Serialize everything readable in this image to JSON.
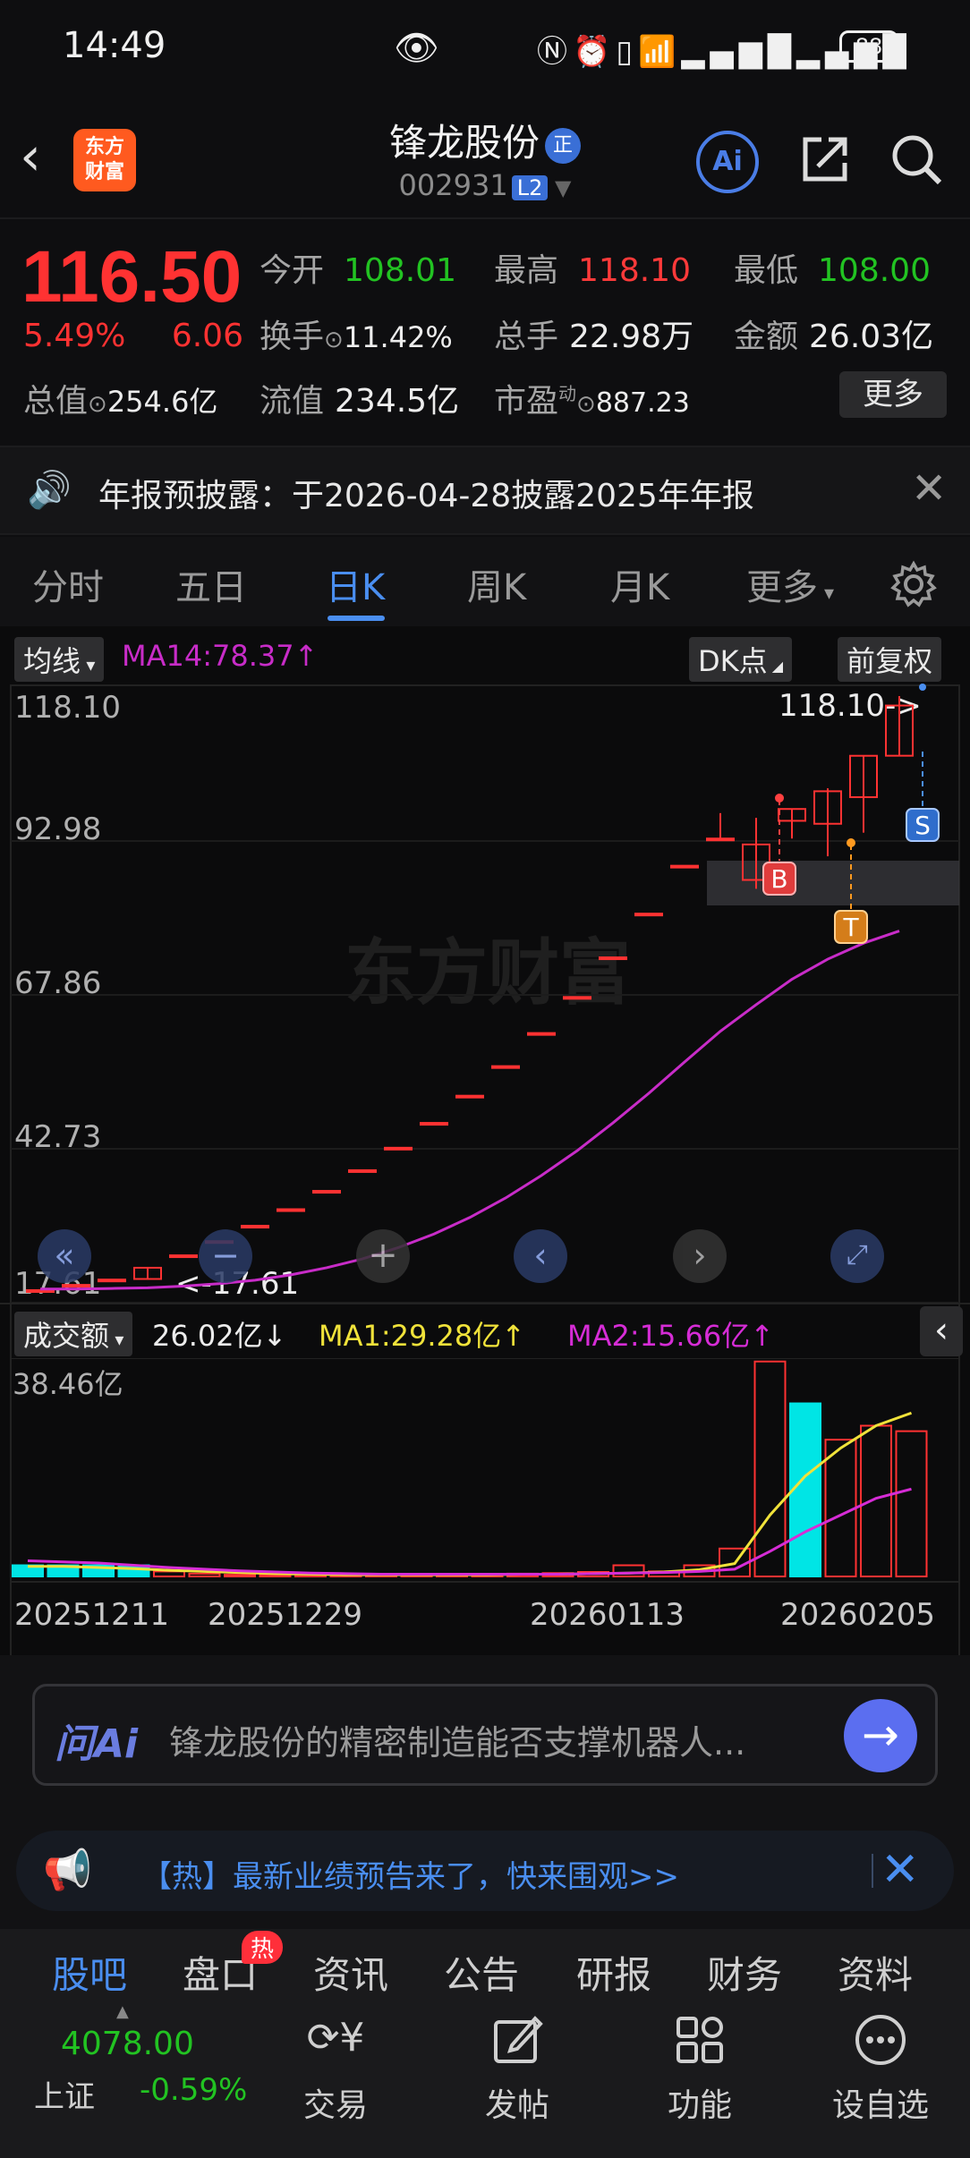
{
  "status_bar": {
    "time": "14:49",
    "battery": "88"
  },
  "header": {
    "stock_name": "锋龙股份",
    "badge": "正",
    "code": "002931",
    "level": "L2",
    "ai_label": "Ai"
  },
  "quote": {
    "price": "116.50",
    "change_pct": "5.49%",
    "change": "6.06",
    "open_label": "今开",
    "open": "108.01",
    "high_label": "最高",
    "high": "118.10",
    "low_label": "最低",
    "low": "108.00",
    "turnover_label": "换手",
    "turnover": "11.42%",
    "volume_label": "总手",
    "volume": "22.98万",
    "amount_label": "金额",
    "amount": "26.03亿",
    "mktcap_label": "总值",
    "mktcap": "254.6亿",
    "float_label": "流值",
    "float": "234.5亿",
    "pe_label": "市盈",
    "pe_sup": "动",
    "pe": "887.23",
    "more": "更多"
  },
  "notice": {
    "text": "年报预披露：于2026-04-28披露2025年年报"
  },
  "tabs": [
    "分时",
    "五日",
    "日K",
    "周K",
    "月K",
    "更多"
  ],
  "kline": {
    "ma_selector": "均线",
    "ma_label": "MA14:78.37↑",
    "dk_button": "DK点",
    "adjust_button": "前复权",
    "y_ticks": [
      "118.10",
      "92.98",
      "67.86",
      "42.73",
      "17.61"
    ],
    "max_label": "118.10->",
    "min_label": "<-17.61",
    "watermark": "东方财富",
    "markers": {
      "b": "B",
      "t": "T",
      "s": "S"
    }
  },
  "volume": {
    "selector": "成交额",
    "value": "26.02亿↓",
    "ma1": "MA1:29.28亿↑",
    "ma2": "MA2:15.66亿↑",
    "y_max": "38.46亿",
    "x_ticks": [
      "20251211",
      "20251229",
      "20260113",
      "20260205"
    ]
  },
  "chart_data": {
    "type": "candlestick",
    "price_axis": [
      17.61,
      118.1
    ],
    "ohlc": [
      [
        17.61,
        17.61,
        17.61,
        17.61
      ],
      [
        18.5,
        18.5,
        18.5,
        18.5
      ],
      [
        19.4,
        19.4,
        19.4,
        19.4
      ],
      [
        19.5,
        21.4,
        19.5,
        21.4
      ],
      [
        23.5,
        23.5,
        23.5,
        23.5
      ],
      [
        25.9,
        25.9,
        25.9,
        25.9
      ],
      [
        28.5,
        28.5,
        28.5,
        28.5
      ],
      [
        31.3,
        31.3,
        31.3,
        31.3
      ],
      [
        34.4,
        34.4,
        34.4,
        34.4
      ],
      [
        37.9,
        37.9,
        37.9,
        37.9
      ],
      [
        41.7,
        41.7,
        41.7,
        41.7
      ],
      [
        45.9,
        45.9,
        45.9,
        45.9
      ],
      [
        50.5,
        50.5,
        50.5,
        50.5
      ],
      [
        55.5,
        55.5,
        55.5,
        55.5
      ],
      [
        61.1,
        61.1,
        61.1,
        61.1
      ],
      [
        67.2,
        67.2,
        67.2,
        67.2
      ],
      [
        73.9,
        73.9,
        73.9,
        73.9
      ],
      [
        81.3,
        81.3,
        81.3,
        81.3
      ],
      [
        89.4,
        89.4,
        89.4,
        89.4
      ],
      [
        94.0,
        98.3,
        94.0,
        94.0
      ],
      [
        87.0,
        97.5,
        85.5,
        93.0
      ],
      [
        97.0,
        99.0,
        94.0,
        99.0
      ],
      [
        96.5,
        102.5,
        91.0,
        102.0
      ],
      [
        101.0,
        108.0,
        95.0,
        108.0
      ],
      [
        108.01,
        118.1,
        108.0,
        116.5
      ]
    ],
    "ma14": [
      17.8,
      17.8,
      17.9,
      18.0,
      18.3,
      18.7,
      19.3,
      20.2,
      21.4,
      22.9,
      24.8,
      27.1,
      29.9,
      33.2,
      37.0,
      41.2,
      45.9,
      50.9,
      56.2,
      61.4,
      65.9,
      70.2,
      73.6,
      76.3,
      78.37
    ],
    "volume_axis_max": 38.46,
    "volume_values": [
      2.0,
      2.0,
      2.0,
      2.0,
      0.9,
      0.5,
      0.3,
      0.3,
      0.2,
      0.2,
      0.3,
      0.3,
      0.3,
      0.4,
      0.5,
      0.6,
      0.8,
      2.0,
      0.9,
      2.0,
      5.0,
      38.5,
      31.0,
      24.5,
      27.0,
      26.02
    ],
    "vol_ma1": [
      1.8,
      1.8,
      1.6,
      1.4,
      1.1,
      0.9,
      0.7,
      0.5,
      0.4,
      0.3,
      0.3,
      0.3,
      0.3,
      0.3,
      0.4,
      0.4,
      0.5,
      0.6,
      0.8,
      1.2,
      2.3,
      11.0,
      18.0,
      23.0,
      27.0,
      29.28
    ],
    "vol_ma2": [
      2.8,
      2.6,
      2.4,
      2.0,
      1.6,
      1.3,
      1.0,
      0.8,
      0.6,
      0.5,
      0.4,
      0.4,
      0.4,
      0.4,
      0.4,
      0.4,
      0.5,
      0.6,
      0.7,
      0.9,
      1.3,
      4.5,
      8.0,
      11.0,
      14.0,
      15.66
    ]
  },
  "ai_bar": {
    "brand": "问Ai",
    "question": "锋龙股份的精密制造能否支撑机器人..."
  },
  "hot_banner": {
    "text": "【热】最新业绩预告来了，快来围观>>"
  },
  "bottom_tabs": [
    "股吧",
    "盘口",
    "资讯",
    "公告",
    "研报",
    "财务",
    "资料"
  ],
  "hot_badge": "热",
  "index": {
    "value": "4078.00",
    "name": "上证",
    "change": "-0.59%"
  },
  "toolbar": [
    "交易",
    "发帖",
    "功能",
    "设自选"
  ],
  "colors": {
    "up": "#ff3232",
    "down": "#22c322",
    "accent": "#4a8ef0",
    "ma14": "#c82cc8",
    "ma1": "#f0e23a",
    "ma2": "#d62cd6",
    "volume_down": "#00e5e5"
  }
}
